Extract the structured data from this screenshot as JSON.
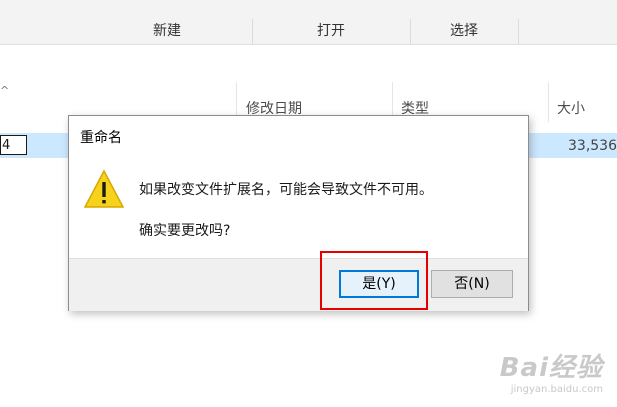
{
  "ribbon": {
    "groups": [
      "新建",
      "打开",
      "选择"
    ]
  },
  "file_list": {
    "sort_indicator": "^",
    "columns": [
      "修改日期",
      "类型",
      "大小"
    ],
    "selected_row": {
      "rename_value": "4",
      "size": "33,536"
    }
  },
  "dialog": {
    "title": "重命名",
    "icon": "warning-icon",
    "message": "如果改变文件扩展名，可能会导致文件不可用。",
    "question": "确实要更改吗?",
    "yes_label": "是(Y)",
    "no_label": "否(N)"
  },
  "watermark": {
    "logo": "Bai经验",
    "url": "jingyan.baidu.com"
  },
  "colors": {
    "selection": "#cce8ff",
    "highlight": "#e60000",
    "default_button_border": "#0078d7",
    "warning_fill": "#f7d21b"
  }
}
